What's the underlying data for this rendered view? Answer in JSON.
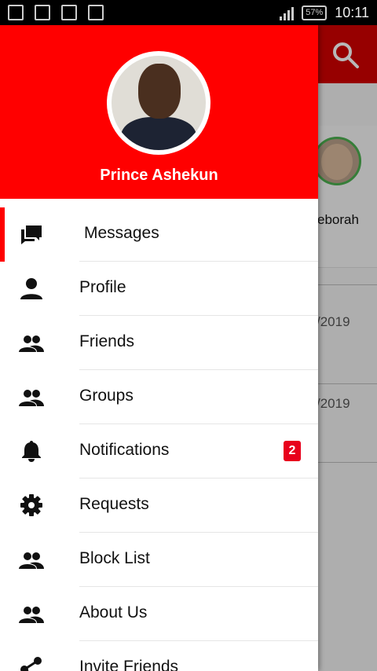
{
  "status_bar": {
    "time": "10:11",
    "battery": "57%",
    "left_icons": [
      "facebook-icon",
      "shirt-icon",
      "image-icon",
      "mail-icon"
    ],
    "right_icons": [
      "data-icon",
      "signal-icon",
      "battery-icon"
    ]
  },
  "background_screen": {
    "toolbar_color": "#d10000",
    "contact_name_partial": "eborah",
    "dates": [
      "/2019",
      "/2019"
    ]
  },
  "drawer": {
    "header_color": "#ff0000",
    "profile_name": "Prince Ashekun",
    "items": [
      {
        "label": "Messages",
        "icon": "chat-icon",
        "active": true
      },
      {
        "label": "Profile",
        "icon": "person-icon"
      },
      {
        "label": "Friends",
        "icon": "people-icon"
      },
      {
        "label": "Groups",
        "icon": "people-icon"
      },
      {
        "label": "Notifications",
        "icon": "bell-icon",
        "badge": "2"
      },
      {
        "label": "Requests",
        "icon": "gear-icon"
      },
      {
        "label": "Block List",
        "icon": "people-icon"
      },
      {
        "label": "About Us",
        "icon": "people-icon"
      },
      {
        "label": "Invite Friends",
        "icon": "share-icon"
      }
    ]
  }
}
